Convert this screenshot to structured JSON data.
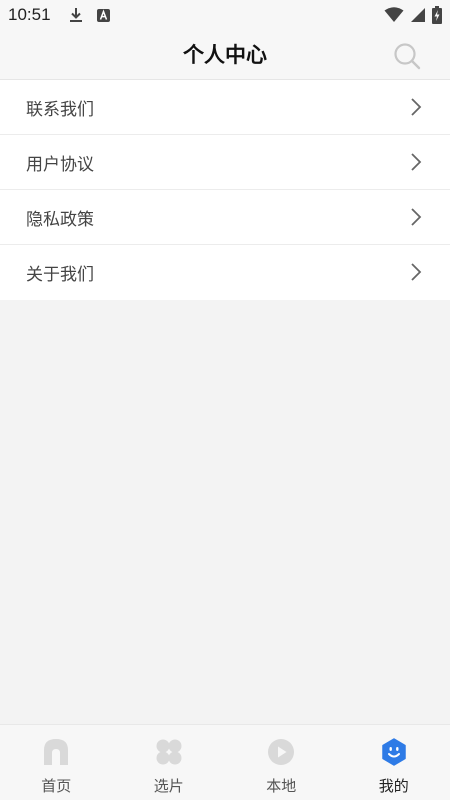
{
  "status_bar": {
    "time": "10:51",
    "icons": [
      "download-icon",
      "a-notification-icon",
      "wifi-icon",
      "signal-icon",
      "battery-charging-icon"
    ]
  },
  "header": {
    "title": "个人中心",
    "search_icon": "search-icon"
  },
  "menu": {
    "items": [
      {
        "label": "联系我们",
        "icon": "chevron-right-icon"
      },
      {
        "label": "用户协议",
        "icon": "chevron-right-icon"
      },
      {
        "label": "隐私政策",
        "icon": "chevron-right-icon"
      },
      {
        "label": "关于我们",
        "icon": "chevron-right-icon"
      }
    ]
  },
  "tabbar": {
    "tabs": [
      {
        "label": "首页",
        "icon": "home-icon",
        "active": false
      },
      {
        "label": "选片",
        "icon": "grid-icon",
        "active": false
      },
      {
        "label": "本地",
        "icon": "play-icon",
        "active": false
      },
      {
        "label": "我的",
        "icon": "profile-face-icon",
        "active": true
      }
    ]
  },
  "colors": {
    "accent": "#2e7be6",
    "icon_inactive": "#d9d9d9",
    "background": "#f3f3f3"
  }
}
